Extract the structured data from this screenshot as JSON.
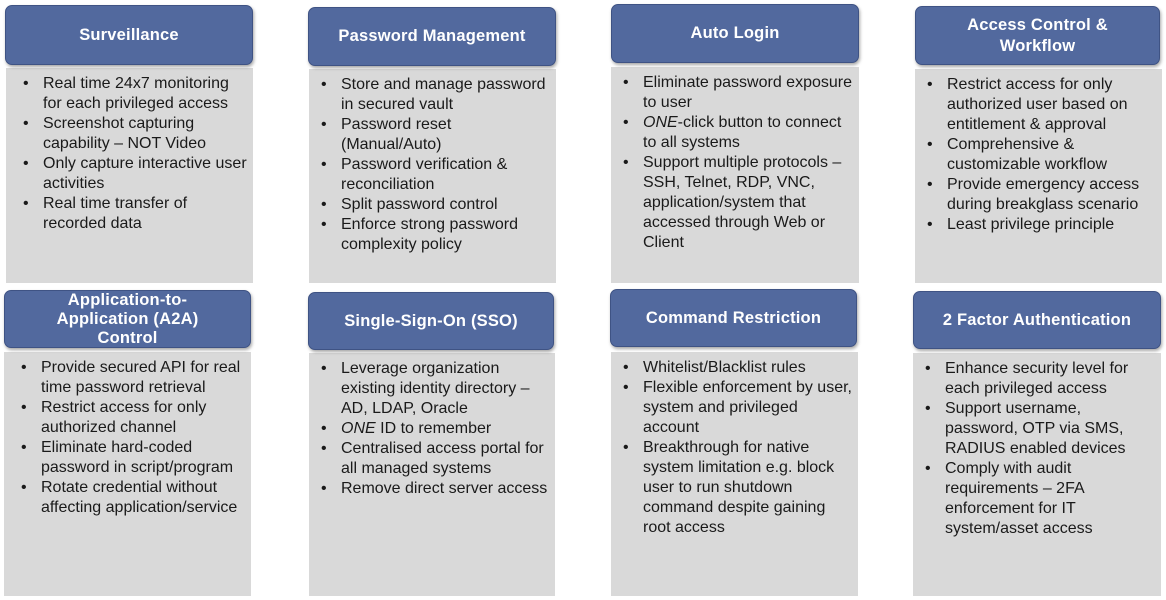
{
  "cards": [
    {
      "title": "Surveillance",
      "items": [
        {
          "text": "Real time 24x7 monitoring for each privileged access"
        },
        {
          "text": "Screenshot capturing capability – NOT Video"
        },
        {
          "text": "Only capture interactive user activities"
        },
        {
          "text": "Real time transfer of recorded data"
        }
      ]
    },
    {
      "title": "Password Management",
      "items": [
        {
          "text": "Store and manage password in secured vault"
        },
        {
          "text": "Password reset (Manual/Auto)"
        },
        {
          "text": "Password verification & reconciliation"
        },
        {
          "text": "Split password control"
        },
        {
          "text": "Enforce strong password complexity policy"
        }
      ]
    },
    {
      "title": "Auto Login",
      "items": [
        {
          "text": "Eliminate password exposure to user"
        },
        {
          "em": "ONE",
          "text": "-click button to connect to all systems"
        },
        {
          "text": "Support multiple protocols – SSH, Telnet, RDP, VNC, application/system that accessed through Web or Client"
        }
      ]
    },
    {
      "title": "Access Control & Workflow",
      "items": [
        {
          "text": "Restrict access for only authorized user based on entitlement & approval"
        },
        {
          "text": "Comprehensive & customizable workflow"
        },
        {
          "text": "Provide emergency access during breakglass scenario"
        },
        {
          "text": "Least privilege principle"
        }
      ]
    },
    {
      "title": "Application-to-Application (A2A) Control",
      "items": [
        {
          "text": "Provide secured API for real time password retrieval"
        },
        {
          "text": "Restrict access for only authorized channel"
        },
        {
          "text": "Eliminate hard-coded password in script/program"
        },
        {
          "text": "Rotate credential without affecting application/service"
        }
      ]
    },
    {
      "title": "Single-Sign-On (SSO)",
      "items": [
        {
          "text": "Leverage organization existing identity directory – AD, LDAP, Oracle"
        },
        {
          "em": "ONE",
          "text": " ID to remember"
        },
        {
          "text": "Centralised access portal for all managed systems"
        },
        {
          "text": "Remove direct server access"
        }
      ]
    },
    {
      "title": "Command Restriction",
      "items": [
        {
          "text": "Whitelist/Blacklist rules"
        },
        {
          "text": "Flexible enforcement by user, system and privileged account"
        },
        {
          "text": "Breakthrough for native system limitation e.g. block user to run shutdown command despite gaining root access"
        }
      ]
    },
    {
      "title": "2 Factor Authentication",
      "items": [
        {
          "text": "Enhance security level for each privileged access"
        },
        {
          "text": "Support username, password, OTP via SMS, RADIUS enabled devices"
        },
        {
          "text": "Comply with audit requirements – 2FA enforcement for IT system/asset access"
        }
      ]
    }
  ]
}
